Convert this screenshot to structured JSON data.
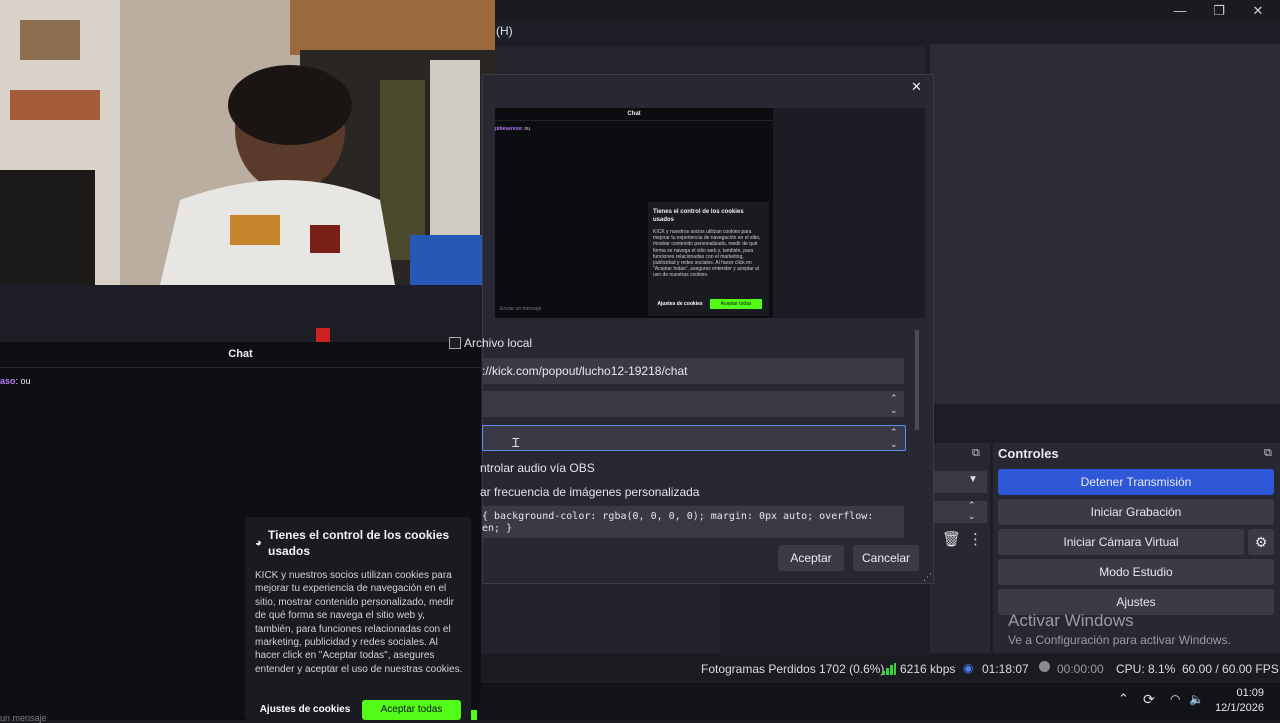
{
  "obs": {
    "menu_partial": "(H)",
    "win_min": "—",
    "win_max": "❐",
    "win_close": "✕",
    "controls": {
      "title": "Controles",
      "buttons": [
        "Detener Transmisión",
        "Iniciar Grabación",
        "Iniciar Cámara Virtual",
        "Modo Estudio",
        "Ajustes"
      ]
    },
    "watermark": {
      "title": "Activar Windows",
      "subtitle": "Ve a Configuración para activar Windows."
    },
    "status": {
      "dropped": "Fotogramas Perdidos 1702 (0.6%)",
      "bitrate": "6216 kbps",
      "stream_time": "01:18:07",
      "rec_time": "00:00:00",
      "cpu": "CPU: 8.1%",
      "fps": "60.00 / 60.00 FPS"
    }
  },
  "taskbar": {
    "time": "01:09",
    "date": "12/1/2026"
  },
  "chat": {
    "header": "Chat",
    "message_user": "aso",
    "message_text": ": ou",
    "input_placeholder": "un mensaje",
    "cookie": {
      "title": "Tienes el control de los cookies usados",
      "body": "KICK y nuestros socios utilizan cookies para mejorar tu experiencia de navegación en el sitio, mostrar contenido personalizado, medir de qué forma se navega el sitio web y, también, para funciones relacionadas con el marketing, publicidad y redes sociales. Al hacer click en \"Aceptar todas\", asegures entender y aceptar el uso de nuestras cookies.",
      "settings": "Ajustes de cookies",
      "accept": "Aceptar todas"
    }
  },
  "dialog": {
    "close": "✕",
    "preview": {
      "chat_header": "Chat",
      "message_user": "pibeservoo",
      "message_text": ": ou",
      "input_placeholder": "Enviar un mensaje",
      "cookie_title": "Tienes el control de los cookies usados",
      "cookie_body": "KICK y nuestros socios utilizan cookies para mejorar tu experiencia de navegación en el sitio, mostrar contenido personalizado, medir de qué forma se navega el sitio web y, también, para funciones relacionadas con el marketing, publicidad y redes sociales. Al hacer click en \"Aceptar todas\", asegures entender y aceptar el uso de nuestras cookies.",
      "cookie_settings": "Ajustes de cookies",
      "cookie_accept": "Aceptar todas"
    },
    "local_file": "Archivo local",
    "url": "://kick.com/popout/lucho12-19218/chat",
    "control_audio": "ntrolar audio vía OBS",
    "custom_fps": "ar frecuencia de imágenes personalizada",
    "css_line1": "{ background-color: rgba(0, 0, 0, 0); margin: 0px auto; overflow:",
    "css_line2": "en; }",
    "ok": "Aceptar",
    "cancel": "Cancelar"
  }
}
